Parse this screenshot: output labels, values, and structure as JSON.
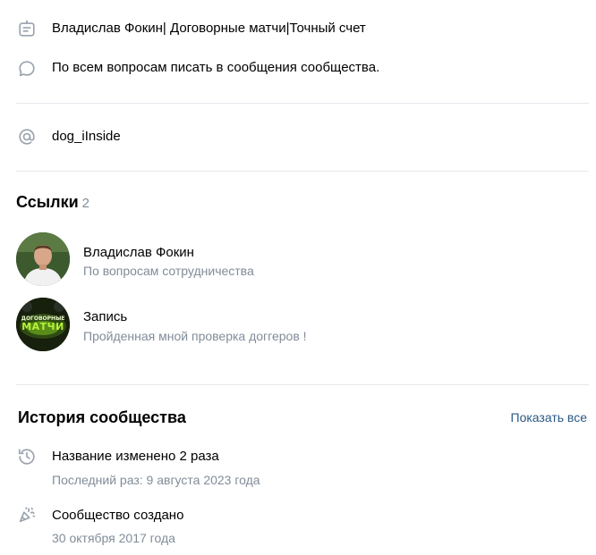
{
  "info": {
    "description": "Владислав Фокин| Договорные матчи|Точный счет",
    "contact_note": "По всем вопросам писать в сообщения сообщества.",
    "handle": "dog_iInside"
  },
  "links": {
    "title": "Ссылки",
    "count": "2",
    "items": [
      {
        "title": "Владислав Фокин",
        "subtitle": "По вопросам сотрудничества"
      },
      {
        "title": "Запись",
        "subtitle": "Пройденная мной проверка доггеров !"
      }
    ],
    "avatar2_text_top": "ДОГОВОРНЫЕ",
    "avatar2_text_main": "МАТЧИ"
  },
  "history": {
    "title": "История сообщества",
    "show_all": "Показать все",
    "items": [
      {
        "title": "Название изменено 2 раза",
        "subtitle": "Последний раз: 9 августа 2023 года"
      },
      {
        "title": "Сообщество создано",
        "subtitle": "30 октября 2017 года"
      }
    ]
  },
  "colors": {
    "icon": "#99a2ad",
    "secondary_text": "#818c99",
    "link": "#2a5885",
    "divider": "#e7e8ec"
  }
}
